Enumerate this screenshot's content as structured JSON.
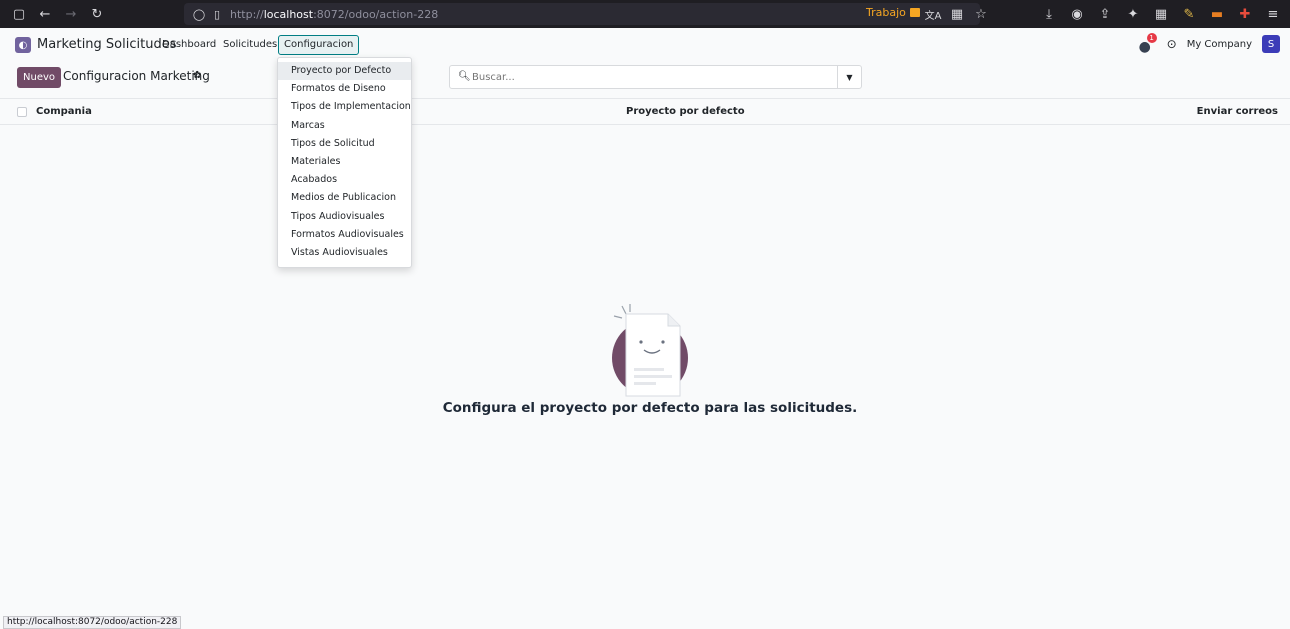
{
  "browser": {
    "url_prefix": "http://",
    "url_host": "localhost",
    "url_path": ":8072/odoo/action-228",
    "container_label": "Trabajo"
  },
  "navbar": {
    "app_name": "Marketing Solicitudes",
    "menus": [
      "Dashboard",
      "Solicitudes",
      "Configuracion"
    ],
    "chat_count": "1",
    "company": "My Company",
    "avatar_initial": "S"
  },
  "control_panel": {
    "new_button": "Nuevo",
    "title": "Configuracion Marketing",
    "search_placeholder": "Buscar..."
  },
  "list": {
    "columns": [
      "Compania",
      "Proyecto por defecto",
      "Enviar correos"
    ]
  },
  "dropdown": {
    "items": [
      "Proyecto por Defecto",
      "Formatos de Diseno",
      "Tipos de Implementacion",
      "Marcas",
      "Tipos de Solicitud",
      "Materiales",
      "Acabados",
      "Medios de Publicacion",
      "Tipos Audiovisuales",
      "Formatos Audiovisuales",
      "Vistas Audiovisuales"
    ],
    "active_index": 0
  },
  "empty_state": {
    "message": "Configura el proyecto por defecto para las solicitudes."
  },
  "status_bar": {
    "url": "http://localhost:8072/odoo/action-228"
  },
  "colors": {
    "primary": "#714b67",
    "accent": "#017e84",
    "badge": "#e63946",
    "avatar": "#3c3cb8"
  }
}
